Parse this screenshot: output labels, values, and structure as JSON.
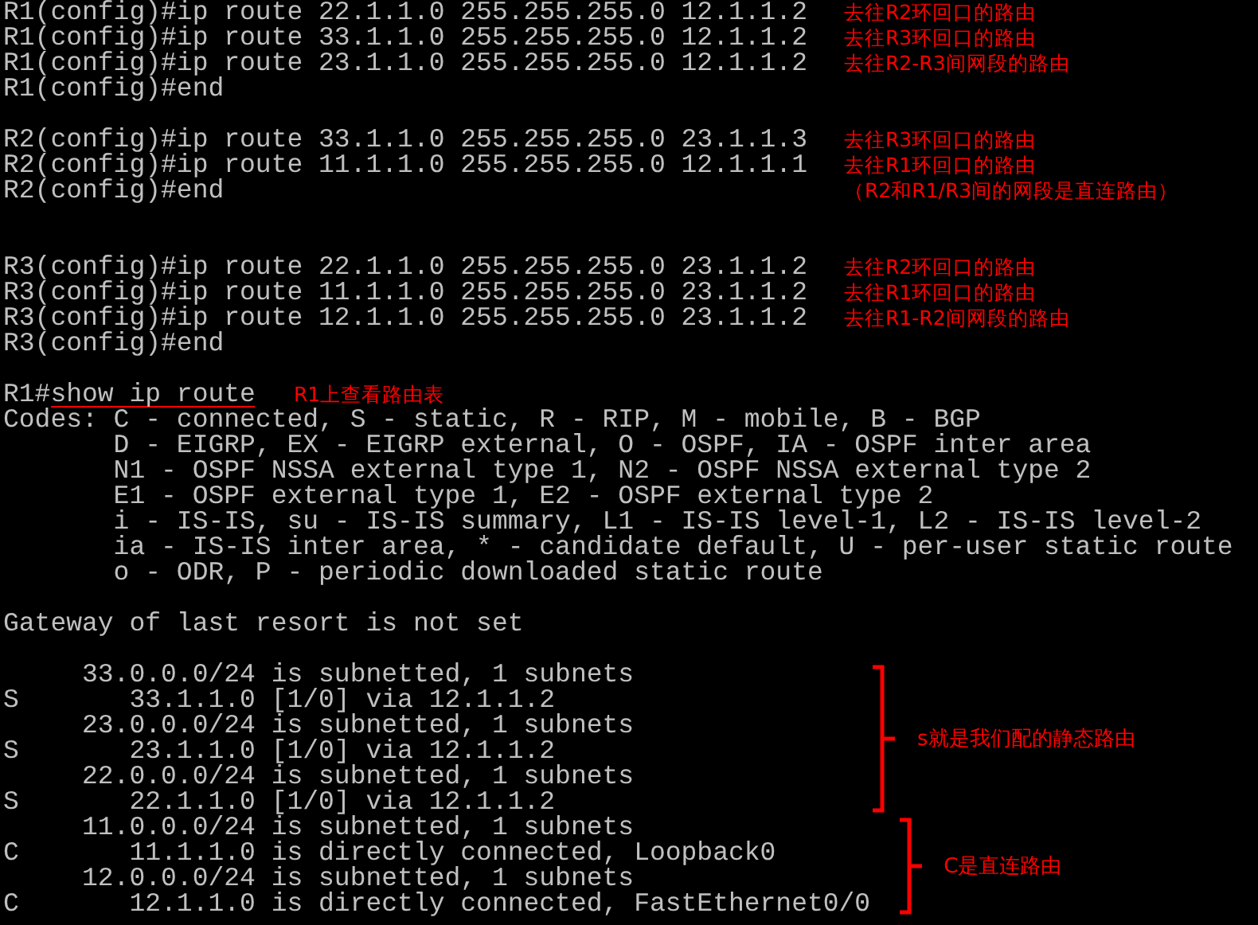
{
  "terminal": {
    "lines": [
      {
        "kind": "line",
        "text": "R1(config)#ip route 22.1.1.0 255.255.255.0 12.1.1.2",
        "note": "去往R2环回口的路由"
      },
      {
        "kind": "line",
        "text": "R1(config)#ip route 33.1.1.0 255.255.255.0 12.1.1.2",
        "note": "去往R3环回口的路由"
      },
      {
        "kind": "line",
        "text": "R1(config)#ip route 23.1.1.0 255.255.255.0 12.1.1.2",
        "note": "去往R2-R3间网段的路由"
      },
      {
        "kind": "line",
        "text": "R1(config)#end"
      },
      {
        "kind": "blank"
      },
      {
        "kind": "line",
        "text": "R2(config)#ip route 33.1.1.0 255.255.255.0 23.1.1.3",
        "note": "去往R3环回口的路由"
      },
      {
        "kind": "line",
        "text": "R2(config)#ip route 11.1.1.0 255.255.255.0 12.1.1.1",
        "note": "去往R1环回口的路由"
      },
      {
        "kind": "line",
        "text": "R2(config)#end",
        "note": "（R2和R1/R3间的网段是直连路由）"
      },
      {
        "kind": "blank"
      },
      {
        "kind": "blank"
      },
      {
        "kind": "line",
        "text": "R3(config)#ip route 22.1.1.0 255.255.255.0 23.1.1.2",
        "note": "去往R2环回口的路由"
      },
      {
        "kind": "line",
        "text": "R3(config)#ip route 11.1.1.0 255.255.255.0 23.1.1.2",
        "note": "去往R1环回口的路由"
      },
      {
        "kind": "line",
        "text": "R3(config)#ip route 12.1.1.0 255.255.255.0 23.1.1.2",
        "note": "去往R1-R2间网段的路由"
      },
      {
        "kind": "line",
        "text": "R3(config)#end"
      },
      {
        "kind": "blank"
      },
      {
        "kind": "command",
        "prompt": "R1#",
        "command": "show ip route",
        "note": "R1上查看路由表"
      },
      {
        "kind": "line",
        "text": "Codes: C - connected, S - static, R - RIP, M - mobile, B - BGP"
      },
      {
        "kind": "line",
        "text": "       D - EIGRP, EX - EIGRP external, O - OSPF, IA - OSPF inter area"
      },
      {
        "kind": "line",
        "text": "       N1 - OSPF NSSA external type 1, N2 - OSPF NSSA external type 2"
      },
      {
        "kind": "line",
        "text": "       E1 - OSPF external type 1, E2 - OSPF external type 2"
      },
      {
        "kind": "line",
        "text": "       i - IS-IS, su - IS-IS summary, L1 - IS-IS level-1, L2 - IS-IS level-2"
      },
      {
        "kind": "line",
        "text": "       ia - IS-IS inter area, * - candidate default, U - per-user static route"
      },
      {
        "kind": "line",
        "text": "       o - ODR, P - periodic downloaded static route"
      },
      {
        "kind": "blank"
      },
      {
        "kind": "line",
        "text": "Gateway of last resort is not set"
      },
      {
        "kind": "blank"
      },
      {
        "kind": "group",
        "note": "s就是我们配的静态路由",
        "lines": [
          "     33.0.0.0/24 is subnetted, 1 subnets",
          "S       33.1.1.0 [1/0] via 12.1.1.2",
          "     23.0.0.0/24 is subnetted, 1 subnets",
          "S       23.1.1.0 [1/0] via 12.1.1.2",
          "     22.0.0.0/24 is subnetted, 1 subnets",
          "S       22.1.1.0 [1/0] via 12.1.1.2"
        ]
      },
      {
        "kind": "group",
        "note": "C是直连路由",
        "lines": [
          "     11.0.0.0/24 is subnetted, 1 subnets",
          "C       11.1.1.0 is directly connected, Loopback0",
          "     12.0.0.0/24 is subnetted, 1 subnets",
          "C       12.1.1.0 is directly connected, FastEthernet0/0"
        ]
      }
    ]
  }
}
